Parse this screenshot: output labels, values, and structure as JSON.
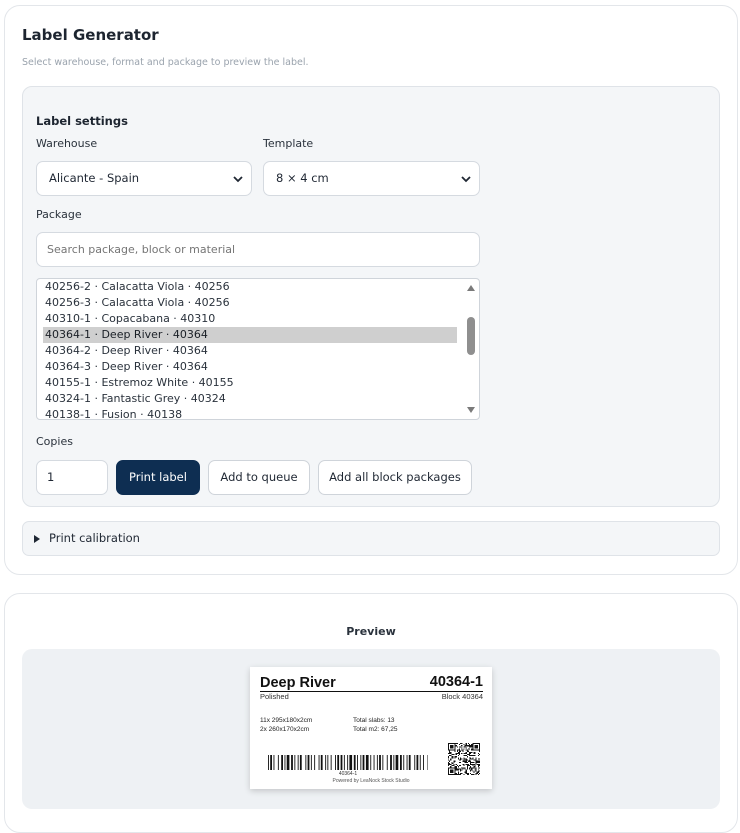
{
  "header": {
    "title": "Label Generator",
    "subtitle": "Select warehouse, format and package to preview the label."
  },
  "settings": {
    "title": "Label settings",
    "warehouse_label": "Warehouse",
    "warehouse_value": "Alicante - Spain",
    "template_label": "Template",
    "template_value": "8 × 4 cm",
    "package_label": "Package",
    "search_placeholder": "Search package, block or material",
    "packages": [
      "40256-2 · Calacatta Viola · 40256",
      "40256-3 · Calacatta Viola · 40256",
      "40310-1 · Copacabana · 40310",
      "40364-1 · Deep River · 40364",
      "40364-2 · Deep River · 40364",
      "40364-3 · Deep River · 40364",
      "40155-1 · Estremoz White · 40155",
      "40324-1 · Fantastic Grey · 40324",
      "40138-1 · Fusion · 40138"
    ],
    "selected_package": "40364-1 · Deep River · 40364",
    "copies_label": "Copies",
    "copies_value": "1",
    "print_label": "Print label",
    "queue_label": "Add to queue",
    "add_all_label": "Add all block packages"
  },
  "calibration": {
    "label": "Print calibration"
  },
  "preview": {
    "title": "Preview",
    "label": {
      "material": "Deep River",
      "code": "40364-1",
      "finish": "Polished",
      "block": "Block 40364",
      "size_1": "11x 295x180x2cm",
      "size_2": "2x 260x170x2cm",
      "total_slabs": "Total slabs: 13",
      "total_m2": "Total m2: 67,25",
      "barcode_text": "40364-1",
      "powered_by": "Powered by LeaNock Stock Studio"
    }
  },
  "colors": {
    "primary_button": "#0e2e52",
    "selected_row": "#cfcfcf",
    "panel_bg": "#f4f6f8"
  },
  "icons": {
    "select_arrow": "chevron-down-icon",
    "calibration_toggle": "triangle-right-icon",
    "scroll_up": "scroll-up-arrow-icon",
    "scroll_down": "scroll-down-arrow-icon"
  }
}
